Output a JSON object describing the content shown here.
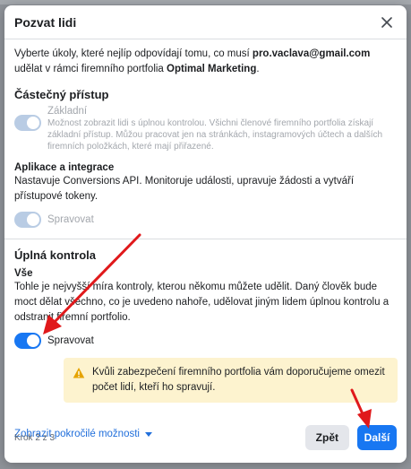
{
  "dialog": {
    "title": "Pozvat lidi",
    "intro_prefix": "Vyberte úkoly, které nejlíp odpovídají tomu, co musí ",
    "intro_email": "pro.vaclava@gmail.com",
    "intro_middle": " udělat v rámci firemního portfolia ",
    "intro_company": "Optimal Marketing",
    "intro_suffix": "."
  },
  "partial": {
    "title": "Částečný přístup",
    "basic": {
      "label": "Základní",
      "description": "Možnost zobrazit lidi s úplnou kontrolou. Všichni členové firemního portfolia získají základní přístup. Můžou pracovat jen na stránkách, instagramových účtech a dalších firemních položkách, které mají přiřazené."
    },
    "apps": {
      "title": "Aplikace a integrace",
      "description": "Nastavuje Conversions API. Monitoruje události, upravuje žádosti a vytváří přístupové tokeny.",
      "toggle_label": "Spravovat"
    }
  },
  "full": {
    "title": "Úplná kontrola",
    "all": {
      "title": "Vše",
      "description": "Tohle je nejvyšší míra kontroly, kterou někomu můžete udělit. Daný člověk bude moct dělat všechno, co je uvedeno nahoře, udělovat jiným lidem úplnou kontrolu a odstranit firemní portfolio.",
      "toggle_label": "Spravovat"
    },
    "warning": "Kvůli zabezpečení firemního portfolia vám doporučujeme omezit počet lidí, kteří ho spravují."
  },
  "advanced_link": "Zobrazit pokročilé možnosti",
  "footer": {
    "step": "Krok 2 z 3",
    "back_label": "Zpět",
    "next_label": "Další"
  },
  "colors": {
    "accent": "#1877f2",
    "toggle_disabled": "#b9cce4",
    "warning_bg": "#fdf3cf",
    "annotation_red": "#e0191b"
  },
  "icons": {
    "close": "close-icon",
    "warning": "warning-icon",
    "caret": "caret-down-icon"
  }
}
